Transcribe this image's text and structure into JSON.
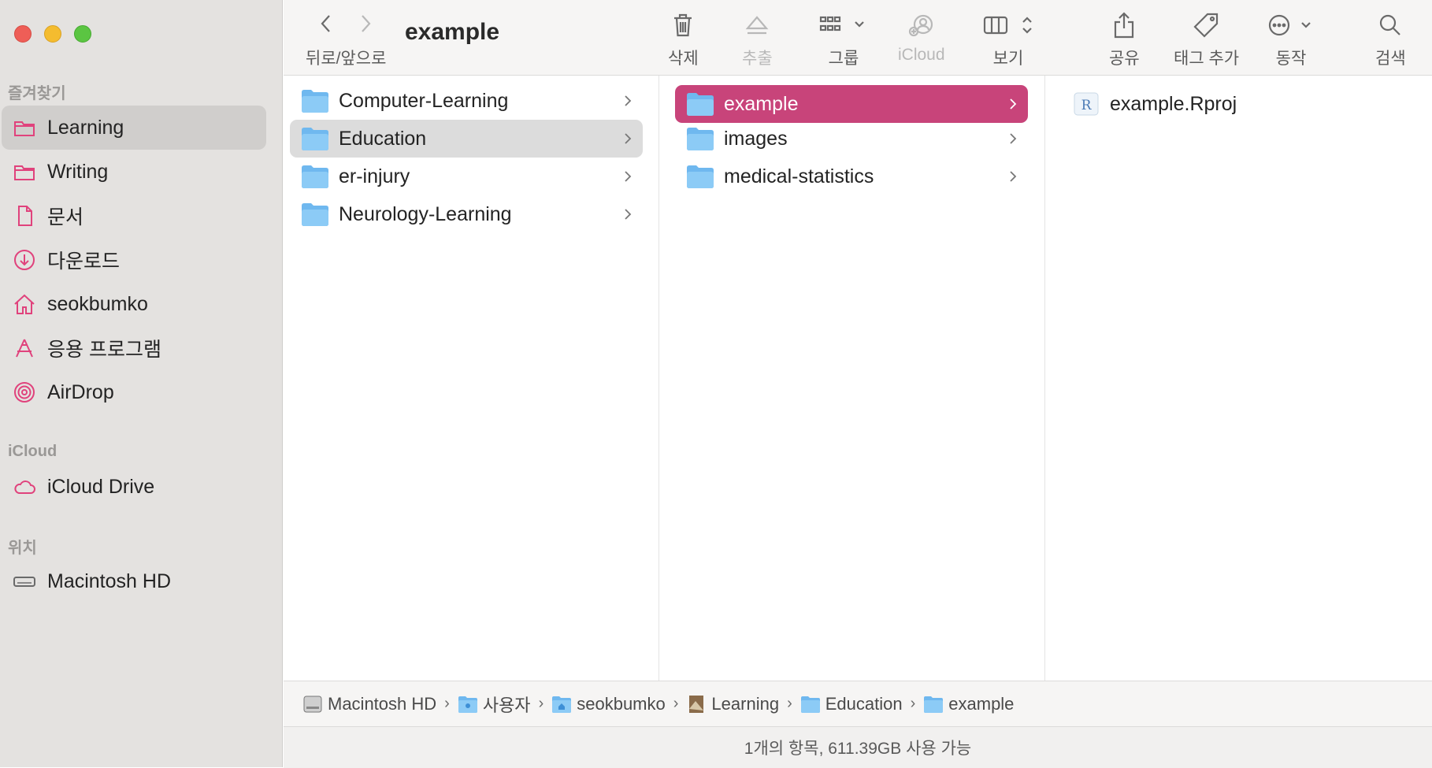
{
  "window": {
    "title": "example"
  },
  "sidebar": {
    "sections": [
      {
        "label": "즐겨찾기"
      },
      {
        "label": "iCloud"
      },
      {
        "label": "위치"
      }
    ],
    "favorites": [
      {
        "label": "Learning",
        "icon": "folder-icon",
        "selected": true
      },
      {
        "label": "Writing",
        "icon": "folder-icon"
      },
      {
        "label": "문서",
        "icon": "document-icon"
      },
      {
        "label": "다운로드",
        "icon": "download-icon"
      },
      {
        "label": "seokbumko",
        "icon": "home-icon"
      },
      {
        "label": "응용 프로그램",
        "icon": "applications-icon"
      },
      {
        "label": "AirDrop",
        "icon": "airdrop-icon"
      }
    ],
    "icloud": [
      {
        "label": "iCloud Drive",
        "icon": "cloud-icon"
      }
    ],
    "locations": [
      {
        "label": "Macintosh HD",
        "icon": "disk-icon"
      }
    ]
  },
  "toolbar": {
    "nav_label": "뒤로/앞으로",
    "delete_label": "삭제",
    "eject_label": "추출",
    "group_label": "그룹",
    "icloud_label": "iCloud",
    "view_label": "보기",
    "share_label": "공유",
    "tag_label": "태그 추가",
    "action_label": "동작",
    "search_label": "검색"
  },
  "columns": {
    "col1": [
      "Computer-Learning",
      "Education",
      "er-injury",
      "Neurology-Learning"
    ],
    "col2": [
      "example",
      "images",
      "medical-statistics"
    ],
    "col3": [
      "example.Rproj"
    ]
  },
  "pathbar": [
    "Macintosh HD",
    "사용자",
    "seokbumko",
    "Learning",
    "Education",
    "example"
  ],
  "status": "1개의 항목, 611.39GB 사용 가능",
  "colors": {
    "accent": "#c8447a",
    "sidebar_icon": "#e0427c",
    "folder": "#6fb8ef"
  }
}
